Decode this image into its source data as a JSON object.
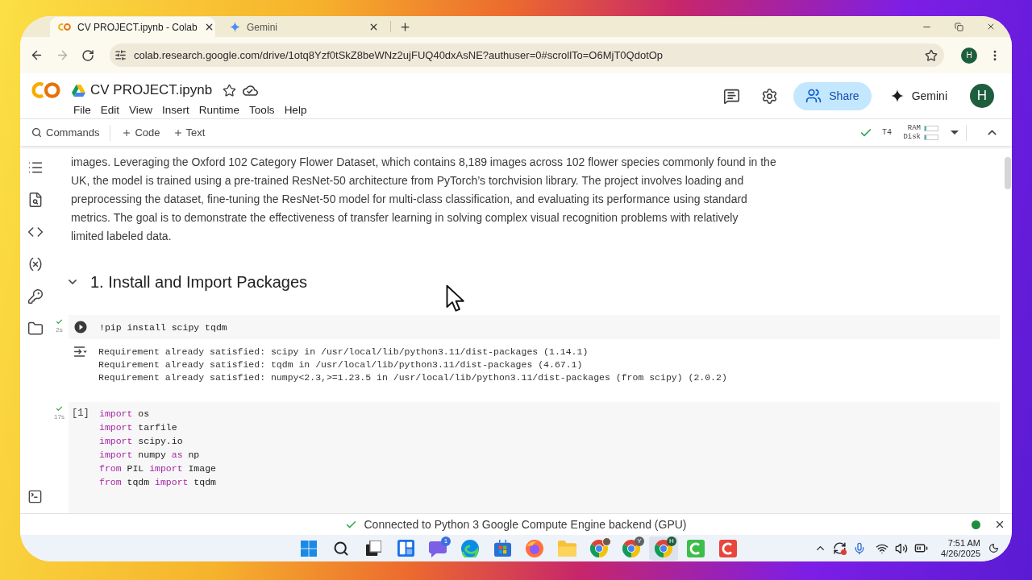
{
  "browser": {
    "tabs": [
      {
        "kind": "colab",
        "title": "CV PROJECT.ipynb - Colab",
        "selected": true
      },
      {
        "kind": "gemini",
        "title": "Gemini",
        "selected": false
      }
    ],
    "forward": {
      "disabled": true
    },
    "url": "colab.research.google.com/drive/1otq8Yzf0tSkZ8beWNz2ujFUQ40dxAsNE?authuser=0#scrollTo=O6MjT0QdotOp",
    "profile": {
      "initial": "H"
    }
  },
  "notebook_header": {
    "title": "CV PROJECT.ipynb",
    "menu": [
      "File",
      "Edit",
      "View",
      "Insert",
      "Runtime",
      "Tools",
      "Help"
    ],
    "share": "Share",
    "gemini": "Gemini",
    "avatar": {
      "initial": "H"
    }
  },
  "toolbar": {
    "commands": "Commands",
    "add": [
      "Code",
      "Text"
    ],
    "runtime": {
      "connected": true,
      "accelerator": "T4",
      "meters": [
        {
          "label": "RAM",
          "level": 0.1
        },
        {
          "label": "Disk",
          "level": 0.1
        }
      ]
    }
  },
  "notebook": {
    "paragraph": {
      "lines": [
        "images. Leveraging the Oxford 102 Category Flower Dataset, which contains 8,189 images across 102 flower species commonly found in the",
        "UK, the model is trained using a pre-trained ResNet-50 architecture from PyTorch’s torchvision library. The project involves loading and",
        "preprocessing the dataset, fine-tuning the ResNet-50 model for multi-class classification, and evaluating its performance using standard",
        "metrics. The goal is to demonstrate the effectiveness of transfer learning in solving complex visual recognition problems with relatively",
        "limited labeled data."
      ]
    },
    "heading": {
      "text": "1. Install and Import Packages",
      "expanded": true
    },
    "cells": [
      {
        "duration": "2s",
        "done": true,
        "code": [
          [
            {
              "kind": "plain",
              "text": "!pip install scipy tqdm"
            }
          ]
        ],
        "output": [
          "Requirement already satisfied: scipy in /usr/local/lib/python3.11/dist-packages (1.14.1)",
          "Requirement already satisfied: tqdm in /usr/local/lib/python3.11/dist-packages (4.67.1)",
          "Requirement already satisfied: numpy<2.3,>=1.23.5 in /usr/local/lib/python3.11/dist-packages (from scipy) (2.0.2)"
        ]
      },
      {
        "count": "[1]",
        "duration": "17s",
        "done": true,
        "code": [
          [
            {
              "kind": "keyword",
              "text": "import"
            },
            {
              "kind": "plain",
              "text": " os"
            }
          ],
          [
            {
              "kind": "keyword",
              "text": "import"
            },
            {
              "kind": "plain",
              "text": " tarfile"
            }
          ],
          [
            {
              "kind": "keyword",
              "text": "import"
            },
            {
              "kind": "plain",
              "text": " scipy.io"
            }
          ],
          [
            {
              "kind": "keyword",
              "text": "import"
            },
            {
              "kind": "plain",
              "text": " numpy "
            },
            {
              "kind": "keyword",
              "text": "as"
            },
            {
              "kind": "plain",
              "text": " np"
            }
          ],
          [
            {
              "kind": "keyword",
              "text": "from"
            },
            {
              "kind": "plain",
              "text": " PIL "
            },
            {
              "kind": "keyword",
              "text": "import"
            },
            {
              "kind": "plain",
              "text": " Image"
            }
          ],
          [
            {
              "kind": "keyword",
              "text": "from"
            },
            {
              "kind": "plain",
              "text": " tqdm "
            },
            {
              "kind": "keyword",
              "text": "import"
            },
            {
              "kind": "plain",
              "text": " tqdm"
            }
          ]
        ]
      }
    ]
  },
  "status_bar": {
    "text": "Connected to Python 3 Google Compute Engine backend (GPU)",
    "connected": true
  },
  "taskbar": {
    "apps": [
      {
        "kind": "start",
        "selected": false
      },
      {
        "kind": "search",
        "selected": false
      },
      {
        "kind": "task_view",
        "selected": false
      },
      {
        "kind": "widgets",
        "selected": false
      },
      {
        "kind": "chat",
        "badge": "1",
        "selected": false
      },
      {
        "kind": "edge",
        "selected": false
      },
      {
        "kind": "store",
        "selected": false
      },
      {
        "kind": "firefox",
        "selected": false
      },
      {
        "kind": "files",
        "selected": false
      },
      {
        "kind": "chrome_photo",
        "selected": false
      },
      {
        "kind": "chrome",
        "badge": "Y",
        "selected": false
      },
      {
        "kind": "chrome",
        "badge": "H",
        "selected": true
      },
      {
        "kind": "recorder_green",
        "selected": false
      },
      {
        "kind": "recorder_red",
        "selected": false
      }
    ],
    "tray": {
      "time": "7:51 AM",
      "date": "4/26/2025"
    }
  }
}
